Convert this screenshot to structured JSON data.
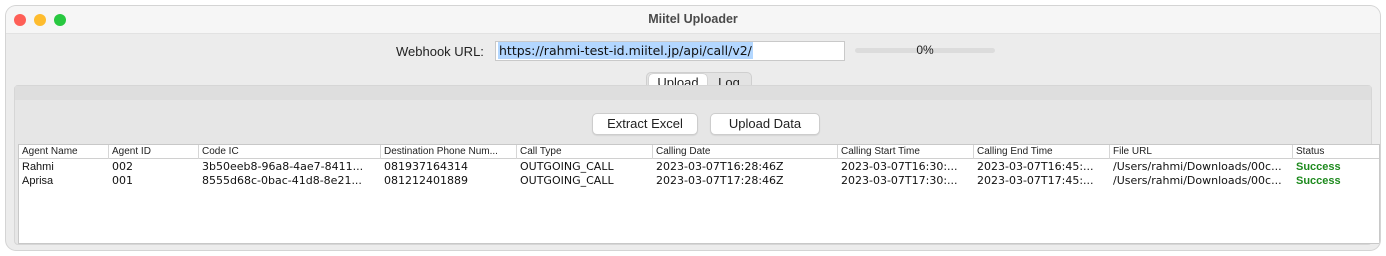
{
  "window": {
    "title": "Miitel Uploader"
  },
  "webhook": {
    "label": "Webhook URL:",
    "value": "https://rahmi-test-id.miitel.jp/api/call/v2/"
  },
  "progress": {
    "percent_text": "0%",
    "fraction": 0
  },
  "tabs": [
    {
      "label": "Upload",
      "selected": true
    },
    {
      "label": "Log",
      "selected": false
    }
  ],
  "actions": {
    "extract_label": "Extract Excel",
    "upload_label": "Upload Data"
  },
  "table": {
    "columns": [
      "Agent Name",
      "Agent ID",
      "Code IC",
      "Destination Phone Num...",
      "Call Type",
      "Calling Date",
      "Calling Start Time",
      "Calling End Time",
      "File URL",
      "Status"
    ],
    "rows": [
      [
        "Rahmi",
        "002",
        "3b50eeb8-96a8-4ae7-8411...",
        "081937164314",
        "OUTGOING_CALL",
        "2023-03-07T16:28:46Z",
        "2023-03-07T16:30:...",
        "2023-03-07T16:45:...",
        "/Users/rahmi/Downloads/00c...",
        "Success"
      ],
      [
        "Aprisa",
        "001",
        "8555d68c-0bac-41d8-8e21...",
        "081212401889",
        "OUTGOING_CALL",
        "2023-03-07T17:28:46Z",
        "2023-03-07T17:30:...",
        "2023-03-07T17:45:...",
        "/Users/rahmi/Downloads/00c...",
        "Success"
      ]
    ]
  },
  "colors": {
    "accent": "#2f7df6",
    "selection": "#b3d7ff",
    "success": "#1e8a1e"
  }
}
